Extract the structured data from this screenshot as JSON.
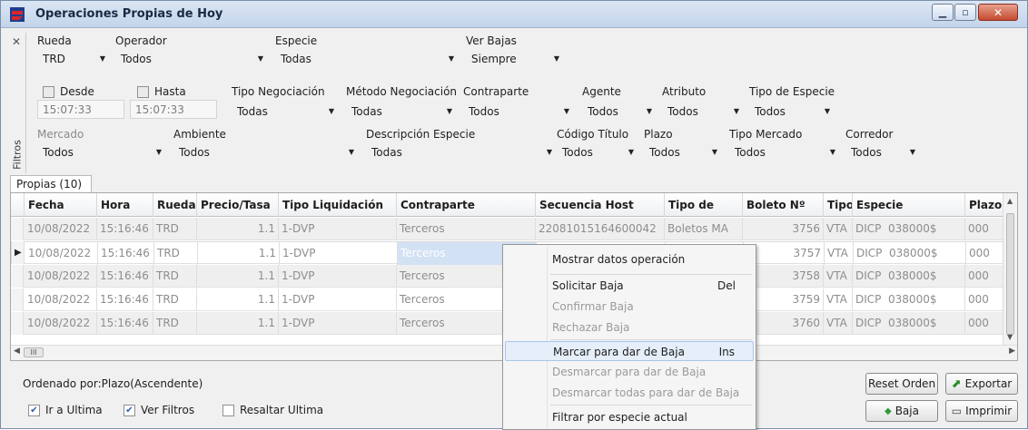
{
  "window": {
    "title": "Operaciones Propias de Hoy"
  },
  "filters": {
    "side_label": "Filtros",
    "rueda": {
      "label": "Rueda",
      "value": "TRD"
    },
    "operador": {
      "label": "Operador",
      "value": "Todos"
    },
    "especie": {
      "label": "Especie",
      "value": "Todas"
    },
    "ver_bajas": {
      "label": "Ver Bajas",
      "value": "Siempre"
    },
    "desde": {
      "label": "Desde",
      "value": "15:07:33",
      "checked": false
    },
    "hasta": {
      "label": "Hasta",
      "value": "15:07:33",
      "checked": false
    },
    "tipo_negociacion": {
      "label": "Tipo Negociación",
      "value": "Todas"
    },
    "metodo_negociacion": {
      "label": "Método Negociación",
      "value": "Todas"
    },
    "contraparte": {
      "label": "Contraparte",
      "value": "Todos"
    },
    "agente": {
      "label": "Agente",
      "value": "Todos"
    },
    "atributo": {
      "label": "Atributo",
      "value": "Todos"
    },
    "tipo_especie": {
      "label": "Tipo de Especie",
      "value": "Todos"
    },
    "mercado": {
      "label": "Mercado",
      "value": "Todos"
    },
    "ambiente": {
      "label": "Ambiente",
      "value": "Todos"
    },
    "descripcion_especie": {
      "label": "Descripción Especie",
      "value": "Todas"
    },
    "codigo_titulo": {
      "label": "Código Título",
      "value": "Todos"
    },
    "plazo": {
      "label": "Plazo",
      "value": "Todos"
    },
    "tipo_mercado": {
      "label": "Tipo Mercado",
      "value": "Todos"
    },
    "corredor": {
      "label": "Corredor",
      "value": "Todos"
    }
  },
  "tab": {
    "label": "Propias (10)"
  },
  "grid": {
    "columns": [
      "Fecha",
      "Hora",
      "Rueda",
      "Precio/Tasa",
      "Tipo Liquidación",
      "Contraparte",
      "Secuencia Host",
      "Tipo de",
      "Boleto Nº",
      "Tipo",
      "Especie",
      "Plazo"
    ],
    "rows": [
      {
        "fecha": "10/08/2022",
        "hora": "15:16:46",
        "rueda": "TRD",
        "precio": "1.1",
        "tipo_liq": "1-DVP",
        "contraparte": "Terceros",
        "secuencia": "22081015164600042",
        "tipo_de": "Boletos MA",
        "boleto": "3756",
        "tipo": "VTA",
        "especie": "DICP  038000$",
        "plazo": "000"
      },
      {
        "fecha": "10/08/2022",
        "hora": "15:16:46",
        "rueda": "TRD",
        "precio": "1.1",
        "tipo_liq": "1-DVP",
        "contraparte": "Terceros",
        "secuencia": "",
        "tipo_de": "",
        "boleto": "3757",
        "tipo": "VTA",
        "especie": "DICP  038000$",
        "plazo": "000"
      },
      {
        "fecha": "10/08/2022",
        "hora": "15:16:46",
        "rueda": "TRD",
        "precio": "1.1",
        "tipo_liq": "1-DVP",
        "contraparte": "Terceros",
        "secuencia": "",
        "tipo_de": "",
        "boleto": "3758",
        "tipo": "VTA",
        "especie": "DICP  038000$",
        "plazo": "000"
      },
      {
        "fecha": "10/08/2022",
        "hora": "15:16:46",
        "rueda": "TRD",
        "precio": "1.1",
        "tipo_liq": "1-DVP",
        "contraparte": "Terceros",
        "secuencia": "",
        "tipo_de": "",
        "boleto": "3759",
        "tipo": "VTA",
        "especie": "DICP  038000$",
        "plazo": "000"
      },
      {
        "fecha": "10/08/2022",
        "hora": "15:16:46",
        "rueda": "TRD",
        "precio": "1.1",
        "tipo_liq": "1-DVP",
        "contraparte": "Terceros",
        "secuencia": "",
        "tipo_de": "",
        "boleto": "3760",
        "tipo": "VTA",
        "especie": "DICP  038000$",
        "plazo": "000"
      }
    ],
    "hscroll_thumb": "III"
  },
  "footer": {
    "ordenado": "Ordenado por:Plazo(Ascendente)",
    "ir_ultima": {
      "label": "Ir a Ultima",
      "checked": true
    },
    "ver_filtros": {
      "label": "Ver Filtros",
      "checked": true
    },
    "resaltar_ultima": {
      "label": "Resaltar Ultima",
      "checked": false
    },
    "reset_orden": "Reset Orden",
    "exportar": "Exportar",
    "baja": "Baja",
    "imprimir": "Imprimir"
  },
  "context_menu": {
    "items": [
      {
        "label": "Mostrar datos operación",
        "shortcut": "",
        "enabled": true
      },
      {
        "label": "Solicitar Baja",
        "shortcut": "Del",
        "enabled": true
      },
      {
        "label": "Confirmar Baja",
        "shortcut": "",
        "enabled": false
      },
      {
        "label": "Rechazar Baja",
        "shortcut": "",
        "enabled": false
      },
      {
        "label": "Marcar para dar de Baja",
        "shortcut": "Ins",
        "enabled": true
      },
      {
        "label": "Desmarcar para dar de Baja",
        "shortcut": "",
        "enabled": false
      },
      {
        "label": "Desmarcar todas para dar de Baja",
        "shortcut": "",
        "enabled": false
      },
      {
        "label": "Filtrar por especie actual",
        "shortcut": "",
        "enabled": true
      }
    ]
  },
  "colors": {
    "titlebar": "#c3d4ea",
    "selected_cell": "#d3e1f5",
    "menu_hover": "#e5eef9"
  }
}
